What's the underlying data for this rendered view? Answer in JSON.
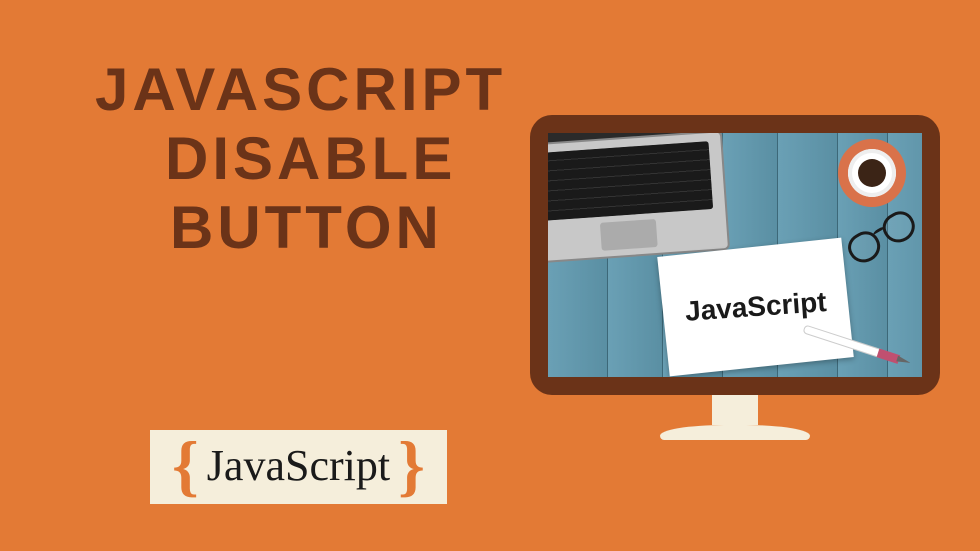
{
  "title": {
    "line1": "JAVASCRIPT",
    "line2": "DISABLE",
    "line3": "BUTTON"
  },
  "monitor": {
    "paper_text": "JavaScript"
  },
  "badge": {
    "open_brace": "{",
    "text": "JavaScript",
    "close_brace": "}"
  }
}
